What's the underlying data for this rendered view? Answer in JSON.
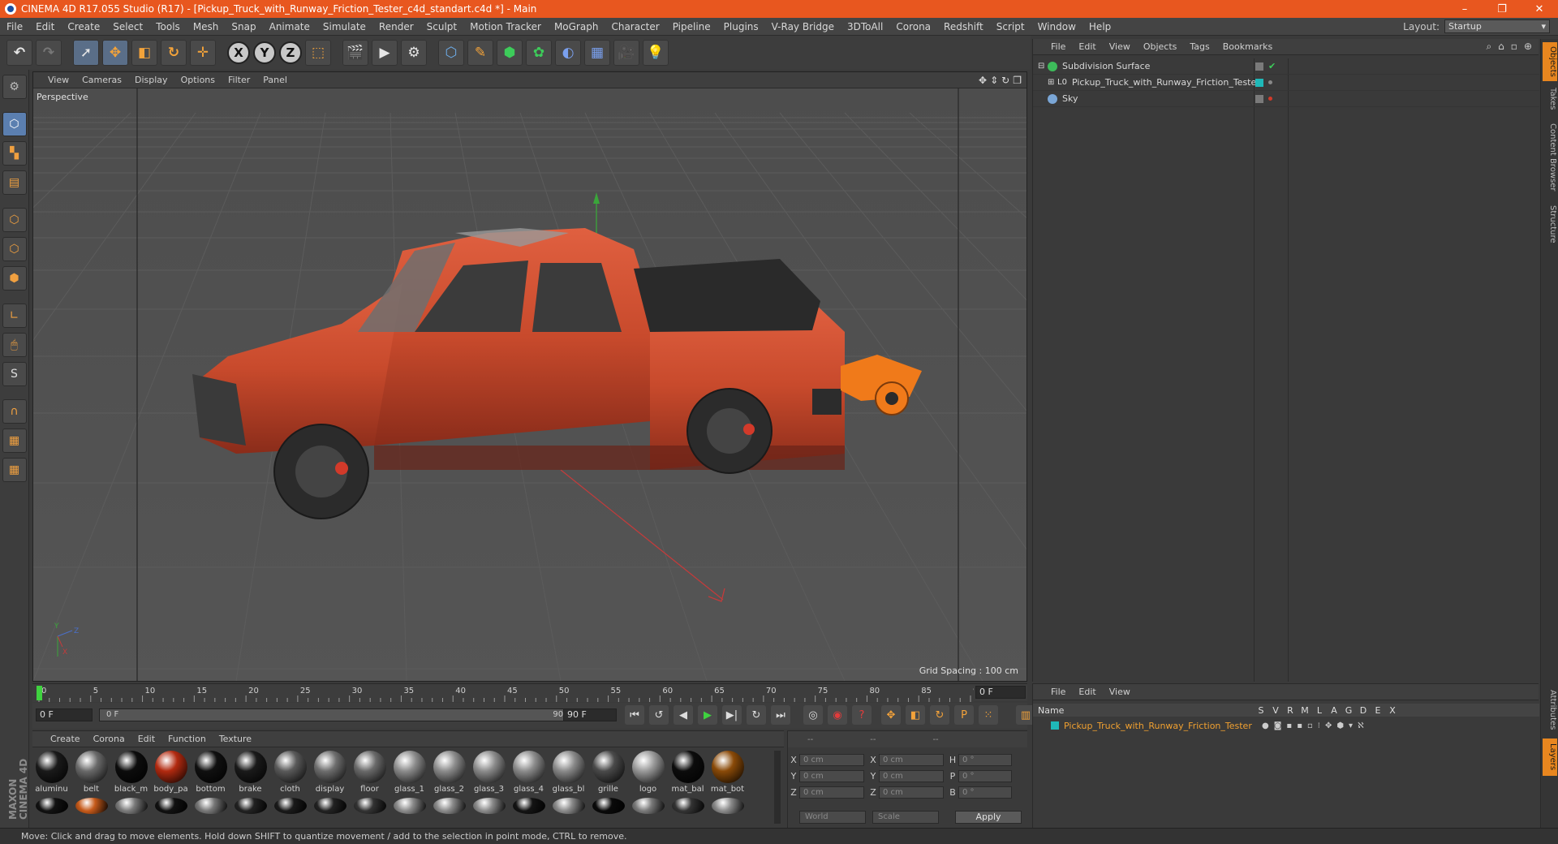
{
  "window": {
    "title": "CINEMA 4D R17.055 Studio (R17) - [Pickup_Truck_with_Runway_Friction_Tester_c4d_standart.c4d *] - Main",
    "controls": [
      "–",
      "❐",
      "✕"
    ]
  },
  "menubar": {
    "items": [
      "File",
      "Edit",
      "Create",
      "Select",
      "Tools",
      "Mesh",
      "Snap",
      "Animate",
      "Simulate",
      "Render",
      "Sculpt",
      "Motion Tracker",
      "MoGraph",
      "Character",
      "Pipeline",
      "Plugins",
      "V-Ray Bridge",
      "3DToAll",
      "Corona",
      "Redshift",
      "Script",
      "Window",
      "Help"
    ],
    "layout_label": "Layout:",
    "layout_value": "Startup"
  },
  "toolbar": {
    "axis_x": "X",
    "axis_y": "Y",
    "axis_z": "Z"
  },
  "viewport": {
    "menu": [
      "View",
      "Cameras",
      "Display",
      "Options",
      "Filter",
      "Panel"
    ],
    "label": "Perspective",
    "grid_spacing": "Grid Spacing : 100 cm"
  },
  "object_manager": {
    "menu": [
      "File",
      "Edit",
      "View",
      "Objects",
      "Tags",
      "Bookmarks"
    ],
    "objects": [
      {
        "name": "Subdivision Surface",
        "icon_color": "#3dbb5a"
      },
      {
        "name": "Pickup_Truck_with_Runway_Friction_Tester",
        "icon_color": "#c8c8c8"
      },
      {
        "name": "Sky",
        "icon_color": "#7aa6d6"
      }
    ]
  },
  "right_tabs": [
    "Objects",
    "Takes",
    "Content Browser",
    "Structure",
    "Attributes",
    "Layers"
  ],
  "timeline": {
    "ticks": [
      "0",
      "5",
      "10",
      "15",
      "20",
      "25",
      "30",
      "35",
      "40",
      "45",
      "50",
      "55",
      "60",
      "65",
      "70",
      "75",
      "80",
      "85",
      "90"
    ],
    "current_frame": "0 F",
    "start_field": "0 F",
    "slider_start": "0 F",
    "slider_end": "90 F",
    "end_field": "90 F"
  },
  "material_manager": {
    "menu": [
      "Create",
      "Corona",
      "Edit",
      "Function",
      "Texture"
    ],
    "materials": [
      {
        "name": "aluminu",
        "color": "#1a1a1a"
      },
      {
        "name": "belt",
        "color": "#6a6a6a"
      },
      {
        "name": "black_m",
        "color": "#0c0c0c"
      },
      {
        "name": "body_pa",
        "color": "#b22a10"
      },
      {
        "name": "bottom",
        "color": "#101010"
      },
      {
        "name": "brake",
        "color": "#1a1a1a"
      },
      {
        "name": "cloth",
        "color": "#5a5a5a"
      },
      {
        "name": "display",
        "color": "#6e6e6e"
      },
      {
        "name": "floor",
        "color": "#6a6a6a"
      },
      {
        "name": "glass_1",
        "color": "#8c8c8c"
      },
      {
        "name": "glass_2",
        "color": "#8c8c8c"
      },
      {
        "name": "glass_3",
        "color": "#8c8c8c"
      },
      {
        "name": "glass_4",
        "color": "#8c8c8c"
      },
      {
        "name": "glass_bl",
        "color": "#8a8a8a"
      },
      {
        "name": "grille",
        "color": "#4a4a4a"
      },
      {
        "name": "logo",
        "color": "#9a9a9a"
      },
      {
        "name": "mat_bal",
        "color": "#0c0c0c"
      },
      {
        "name": "mat_bot",
        "color": "#8a4a08"
      }
    ],
    "second_row_colors": [
      "#121212",
      "#c65a1a",
      "#7a7a7a",
      "#111111",
      "#777777",
      "#222222",
      "#1a1a1a",
      "#222222",
      "#333333",
      "#8a8a8a",
      "#8a8a8a",
      "#8a8a8a",
      "#141414",
      "#8a8a8a",
      "#0a0a0a",
      "#7a7a7a",
      "#333333",
      "#8a8a8a"
    ]
  },
  "coordinates": {
    "header": [
      "--",
      "--",
      "--"
    ],
    "rows": [
      {
        "a": "X",
        "av": "0 cm",
        "b": "X",
        "bv": "0 cm",
        "c": "H",
        "cv": "0 °"
      },
      {
        "a": "Y",
        "av": "0 cm",
        "b": "Y",
        "bv": "0 cm",
        "c": "P",
        "cv": "0 °"
      },
      {
        "a": "Z",
        "av": "0 cm",
        "b": "Z",
        "bv": "0 cm",
        "c": "B",
        "cv": "0 °"
      }
    ],
    "world": "World",
    "scale": "Scale",
    "apply": "Apply"
  },
  "layer_manager": {
    "menu": [
      "File",
      "Edit",
      "View"
    ],
    "col_name": "Name",
    "cols": [
      "S",
      "V",
      "R",
      "M",
      "L",
      "A",
      "G",
      "D",
      "E",
      "X"
    ],
    "layer": "Pickup_Truck_with_Runway_Friction_Tester",
    "layer_color": "#1fb8b8"
  },
  "status": "Move: Click and drag to move elements. Hold down SHIFT to quantize movement / add to the selection in point mode, CTRL to remove.",
  "logo": "MAXON CINEMA 4D"
}
